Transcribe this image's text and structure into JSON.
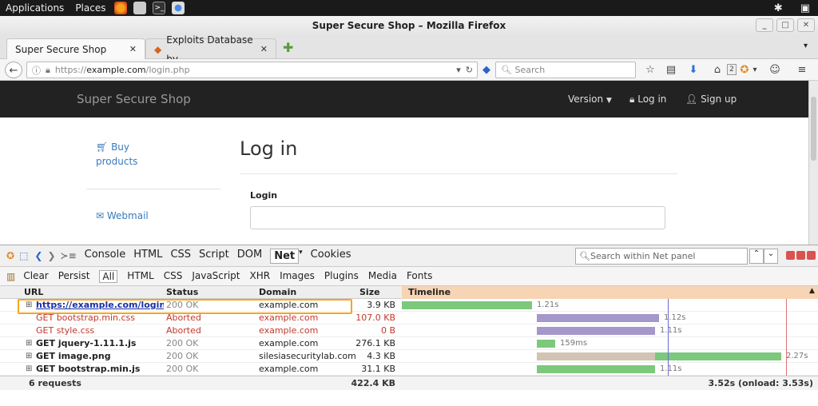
{
  "system": {
    "menu_applications": "Applications",
    "menu_places": "Places"
  },
  "window": {
    "title": "Super Secure Shop – Mozilla Firefox"
  },
  "tabs": [
    {
      "label": "Super Secure Shop",
      "active": true
    },
    {
      "label": "Exploits Database by...",
      "active": false
    }
  ],
  "navbar": {
    "url_prefix": "https://",
    "url_domain": "example.com",
    "url_path": "/login.php",
    "search_placeholder": "Search",
    "downloads_badge": "2"
  },
  "site": {
    "brand": "Super Secure Shop",
    "nav": {
      "version": "Version",
      "login": "Log in",
      "signup": "Sign up"
    },
    "side": {
      "buy": "Buy",
      "products": "products",
      "webmail": "Webmail"
    },
    "heading": "Log in",
    "login_label": "Login"
  },
  "firebug": {
    "tabs": [
      "Console",
      "HTML",
      "CSS",
      "Script",
      "DOM",
      "Net",
      "Cookies"
    ],
    "active_tab": "Net",
    "search_placeholder": "Search within Net panel",
    "subtabs": [
      "Clear",
      "Persist",
      "All",
      "HTML",
      "CSS",
      "JavaScript",
      "XHR",
      "Images",
      "Plugins",
      "Media",
      "Fonts"
    ],
    "active_subtab": "All",
    "columns": {
      "url": "URL",
      "status": "Status",
      "domain": "Domain",
      "size": "Size",
      "timeline": "Timeline"
    },
    "requests": [
      {
        "url": "https://example.com/login.php",
        "status": "200 OK",
        "domain": "example.com",
        "size": "3.9 KB",
        "time": "1.21s",
        "aborted": false,
        "highlight": true,
        "link": true
      },
      {
        "url": "GET bootstrap.min.css",
        "status": "Aborted",
        "domain": "example.com",
        "size": "107.0 KB",
        "time": "1.12s",
        "aborted": true
      },
      {
        "url": "GET style.css",
        "status": "Aborted",
        "domain": "example.com",
        "size": "0 B",
        "time": "1.11s",
        "aborted": true
      },
      {
        "url": "GET jquery-1.11.1.js",
        "status": "200 OK",
        "domain": "example.com",
        "size": "276.1 KB",
        "time": "159ms",
        "aborted": false
      },
      {
        "url": "GET image.png",
        "status": "200 OK",
        "domain": "silesiasecuritylab.com",
        "size": "4.3 KB",
        "time": "2.27s",
        "aborted": false
      },
      {
        "url": "GET bootstrap.min.js",
        "status": "200 OK",
        "domain": "example.com",
        "size": "31.1 KB",
        "time": "1.11s",
        "aborted": false
      }
    ],
    "footer": {
      "count": "6 requests",
      "total_size": "422.4 KB",
      "timing": "3.52s (onload: 3.53s)"
    }
  },
  "colors": {
    "bar_green": "#7cc87c",
    "bar_purple": "#a597c9",
    "bar_tan": "#d3c3b3",
    "aborted_red": "#c0392b",
    "link_blue": "#1a2fa8",
    "highlight": "#f5a623"
  }
}
